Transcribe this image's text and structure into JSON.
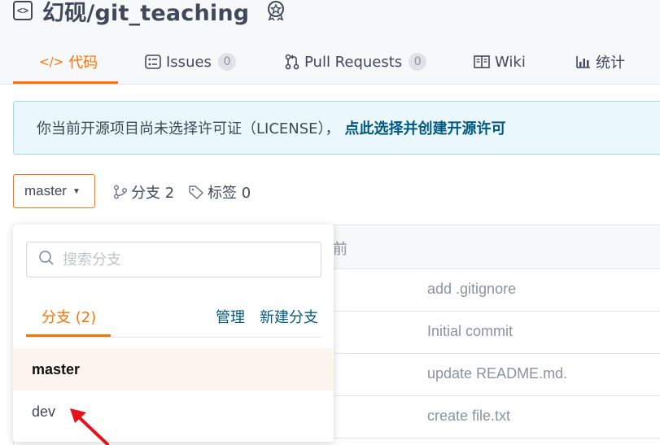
{
  "repo": {
    "name": "幻砚/git_teaching"
  },
  "tabs": {
    "code": {
      "label": "代码"
    },
    "issues": {
      "label": "Issues",
      "count": "0"
    },
    "pull_requests": {
      "label": "Pull Requests",
      "count": "0"
    },
    "wiki": {
      "label": "Wiki"
    },
    "stats": {
      "label": "统计"
    }
  },
  "license_notice": {
    "text": "你当前开源项目尚未选择许可证（LICENSE），",
    "link": "点此选择并创建开源许可"
  },
  "branch_selector": {
    "current": "master"
  },
  "repo_meta": {
    "branches": "分支 2",
    "tags": "标签 0"
  },
  "file_table": {
    "header_fragment": "前",
    "commit_messages": [
      "add .gitignore",
      "Initial commit",
      "update README.md.",
      "create file.txt"
    ]
  },
  "branch_dropdown": {
    "search_placeholder": "搜索分支",
    "tab_label": "分支 (2)",
    "manage_label": "管理",
    "new_branch_label": "新建分支",
    "branches": [
      "master",
      "dev"
    ]
  },
  "colors": {
    "accent": "#fe7300",
    "link": "#005980",
    "annotation_arrow": "#e8121a"
  }
}
